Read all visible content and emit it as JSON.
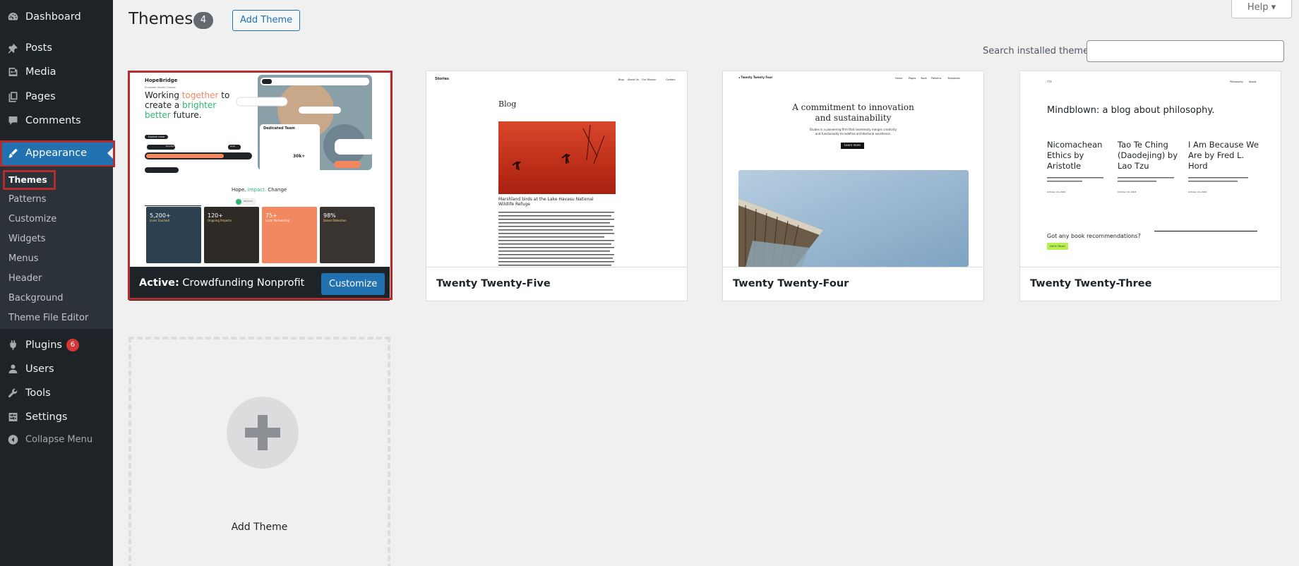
{
  "colors": {
    "sidebar_bg": "#1d2327",
    "submenu_bg": "#2c3338",
    "accent": "#2271b1",
    "highlight": "#b32d2e",
    "badge": "#d63638"
  },
  "sidebar": {
    "items": [
      {
        "label": "Dashboard",
        "icon": "dashboard-icon"
      },
      {
        "label": "Posts",
        "icon": "pin-icon"
      },
      {
        "label": "Media",
        "icon": "media-icon"
      },
      {
        "label": "Pages",
        "icon": "pages-icon"
      },
      {
        "label": "Comments",
        "icon": "comment-icon"
      },
      {
        "label": "Appearance",
        "icon": "brush-icon",
        "current": true
      },
      {
        "label": "Plugins",
        "icon": "plugin-icon",
        "badge": "6"
      },
      {
        "label": "Users",
        "icon": "user-icon"
      },
      {
        "label": "Tools",
        "icon": "wrench-icon"
      },
      {
        "label": "Settings",
        "icon": "settings-icon"
      }
    ],
    "submenu": [
      "Themes",
      "Patterns",
      "Customize",
      "Widgets",
      "Menus",
      "Header",
      "Background",
      "Theme File Editor"
    ],
    "collapse": "Collapse Menu"
  },
  "header": {
    "title": "Themes",
    "count": "4",
    "add_theme": "Add Theme",
    "help": "Help"
  },
  "search": {
    "label": "Search installed themes",
    "value": ""
  },
  "themes": [
    {
      "name": "Crowdfunding Nonprofit",
      "active_prefix": "Active:",
      "customize": "Customize"
    },
    {
      "name": "Twenty Twenty-Five"
    },
    {
      "name": "Twenty Twenty-Four"
    },
    {
      "name": "Twenty Twenty-Three"
    }
  ],
  "previews": {
    "hope": {
      "logo": "HopeBridge",
      "kicker": "Empower Hearts Change",
      "h1a": "Working ",
      "h1b": "together",
      "h1c": " to",
      "h2a": "create a ",
      "h2b": "brighter",
      "h3a": "better",
      "h3b": " future.",
      "cta": "Explore more",
      "s_pill1": "Donation Received",
      "s_pill2": "Goal",
      "card_title": "Dedicated Team",
      "team_count": "30k+",
      "chip": "RESULTS",
      "tag_a": "Hope. ",
      "tag_b": "Impact. ",
      "tag_c": "Change",
      "stats": [
        {
          "value": "5,200+",
          "label": "Lives Touched"
        },
        {
          "value": "120+",
          "label": "Ongoing Projects"
        },
        {
          "value": "75+",
          "label": "Local Partnership"
        },
        {
          "value": "98%",
          "label": "Donor Retention"
        }
      ]
    },
    "tt5": {
      "brand": "Stories",
      "nav": [
        "Blog",
        "About Us",
        "Our Mission",
        "Contact"
      ],
      "heading": "Blog",
      "caption": "Marshland birds at the Lake Havasu National Wildlife Refuge"
    },
    "tt4": {
      "brand": "Twenty Twenty Four",
      "nav": [
        "Home",
        "Pages",
        "Tools",
        "Patterns",
        "Templates"
      ],
      "h1": "A commitment to innovation",
      "h2": "and sustainability",
      "lead1": "Etudes is a pioneering firm that seamlessly merges creativity",
      "lead2": "and functionality to redefine architectural excellence.",
      "btn": "Learn more"
    },
    "tt3": {
      "brand": "TT3",
      "nav": [
        "Philosophy",
        "About"
      ],
      "title": "Mindblown: a blog about philosophy.",
      "posts": [
        {
          "t1": "Nicomachean",
          "t2": "Ethics by",
          "t3": "Aristotle",
          "date": "October 19, 2023"
        },
        {
          "t1": "Tao Te Ching",
          "t2": "(Daodejing) by",
          "t3": "Lao Tzu",
          "date": "October 19, 2023"
        },
        {
          "t1": "I Am Because We",
          "t2": "Are by Fred L.",
          "t3": "Hord",
          "date": "October 19, 2023"
        }
      ],
      "cta": "Got any book recommendations?",
      "btn": "Get In Touch"
    }
  },
  "add_new": {
    "label": "Add Theme"
  }
}
